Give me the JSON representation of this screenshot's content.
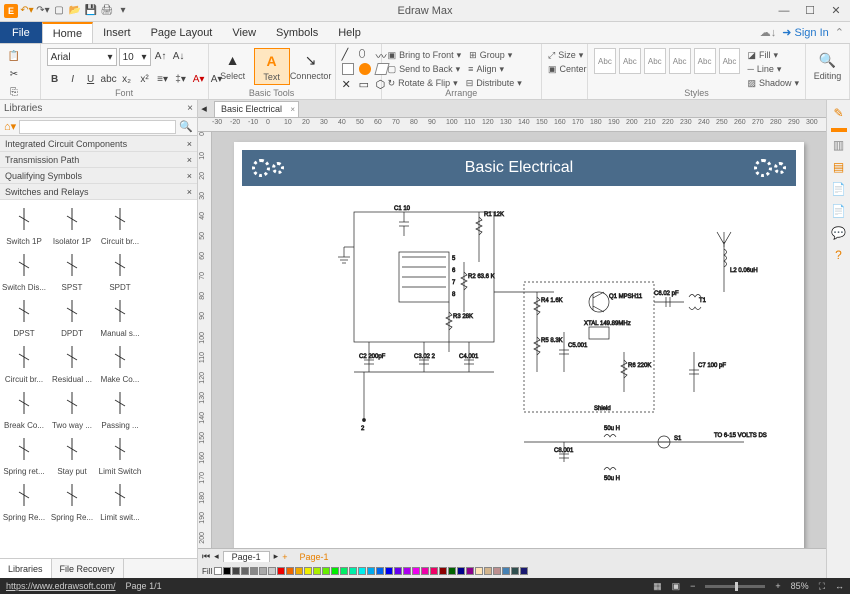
{
  "app_title": "Edraw Max",
  "signin": "Sign In",
  "menus": {
    "file": "File",
    "home": "Home",
    "insert": "Insert",
    "page_layout": "Page Layout",
    "view": "View",
    "symbols": "Symbols",
    "help": "Help"
  },
  "ribbon": {
    "font": {
      "name": "Arial",
      "size": "10",
      "group": "Font"
    },
    "basic_tools": {
      "select": "Select",
      "text": "Text",
      "connector": "Connector",
      "group": "Basic Tools"
    },
    "arrange": {
      "bring_front": "Bring to Front",
      "send_back": "Send to Back",
      "rotate_flip": "Rotate & Flip",
      "group_cmd": "Group",
      "align": "Align",
      "distribute": "Distribute",
      "size": "Size",
      "center": "Center",
      "group": "Arrange"
    },
    "styles": {
      "thumb": "Abc",
      "fill": "Fill",
      "line": "Line",
      "shadow": "Shadow",
      "group": "Styles"
    },
    "editing": {
      "label": "Editing"
    }
  },
  "sidebar": {
    "title": "Libraries",
    "search_placeholder": "",
    "cats": [
      {
        "label": "Integrated Circuit Components"
      },
      {
        "label": "Transmission Path"
      },
      {
        "label": "Qualifying Symbols"
      },
      {
        "label": "Switches and Relays"
      }
    ],
    "shapes": [
      [
        "Switch 1P",
        "Isolator 1P",
        "Circuit br..."
      ],
      [
        "Switch Dis...",
        "SPST",
        "SPDT"
      ],
      [
        "DPST",
        "DPDT",
        "Manual s..."
      ],
      [
        "Circuit br...",
        "Residual ...",
        "Make Co..."
      ],
      [
        "Break Co...",
        "Two way ...",
        "Passing ..."
      ],
      [
        "Spring ret...",
        "Stay put",
        "Limit Switch"
      ],
      [
        "Spring Re...",
        "Spring Re...",
        "Limit swit..."
      ]
    ],
    "tabs": {
      "libraries": "Libraries",
      "file_recovery": "File Recovery"
    }
  },
  "doc": {
    "tab": "Basic Electrical",
    "banner": "Basic Electrical"
  },
  "circuit_labels": {
    "c1": "C1 10",
    "r1": "R1\n12K",
    "r2": "R2\n63.6\nK",
    "r3": "R3\n28K",
    "c2": "C2 200pF",
    "c3": "C3.02\n2",
    "c4": "C4.001",
    "r4": "R4\n1.6K",
    "r5": "R5\n8.3K",
    "c5": "C5.001",
    "q1": "Q1\nMPSH11",
    "xtal": "XTAL\n149.89MHz",
    "r6": "R6\n220K",
    "c6": "C6.02 pF",
    "t1": "T1",
    "l2": "L2\n0.06uH",
    "c7": "C7 100\npF",
    "shield": "Shield",
    "c8": "C8.001",
    "l50a": "50u\nH",
    "l50b": "50u\nH",
    "s1": "S1",
    "out": "TO\n6-15\nVOLTS\nDS",
    "node2": "2"
  },
  "ruler_h": [
    "-30",
    "-20",
    "-10",
    "0",
    "10",
    "20",
    "30",
    "40",
    "50",
    "60",
    "70",
    "80",
    "90",
    "100",
    "110",
    "120",
    "130",
    "140",
    "150",
    "160",
    "170",
    "180",
    "190",
    "200",
    "210",
    "220",
    "230",
    "240",
    "250",
    "260",
    "270",
    "280",
    "290",
    "300"
  ],
  "ruler_v": [
    "0",
    "10",
    "20",
    "30",
    "40",
    "50",
    "60",
    "70",
    "80",
    "90",
    "100",
    "110",
    "120",
    "130",
    "140",
    "150",
    "160",
    "170",
    "180",
    "190",
    "200"
  ],
  "page_tabs": {
    "p1": "Page-1",
    "p2": "Page-1"
  },
  "fill_label": "Fill",
  "swatches": [
    "#fff",
    "#000",
    "#444",
    "#666",
    "#888",
    "#aaa",
    "#ccc",
    "#e00",
    "#e60",
    "#ea0",
    "#ee0",
    "#ae0",
    "#6e0",
    "#0e0",
    "#0e6",
    "#0ea",
    "#0ee",
    "#0ae",
    "#06e",
    "#00e",
    "#60e",
    "#a0e",
    "#e0e",
    "#e0a",
    "#e06",
    "#8b0000",
    "#006400",
    "#00008b",
    "#8b008b",
    "#ffe4b5",
    "#d2b48c",
    "#bc8f8f",
    "#4682b4",
    "#2f4f4f",
    "#191970"
  ],
  "status": {
    "url": "https://www.edrawsoft.com/",
    "page": "Page 1/1",
    "zoom": "85%"
  }
}
